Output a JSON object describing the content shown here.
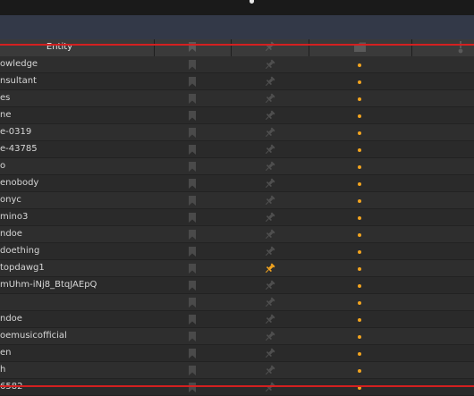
{
  "header": {
    "entity_label": "Entity",
    "columns": [
      "bookmark-icon",
      "pin-icon",
      "status-icon",
      "info-icon"
    ]
  },
  "colors": {
    "accent_red": "#d42020",
    "status_dot": "#f2a41f",
    "pin_active": "#f2a41f"
  },
  "rows": [
    {
      "entity": "owledge",
      "pinned": false
    },
    {
      "entity": "nsultant",
      "pinned": false
    },
    {
      "entity": "es",
      "pinned": false
    },
    {
      "entity": "ne",
      "pinned": false
    },
    {
      "entity": "e-0319",
      "pinned": false
    },
    {
      "entity": "e-43785",
      "pinned": false
    },
    {
      "entity": "o",
      "pinned": false
    },
    {
      "entity": "enobody",
      "pinned": false
    },
    {
      "entity": "onyc",
      "pinned": false
    },
    {
      "entity": "mino3",
      "pinned": false
    },
    {
      "entity": "ndoe",
      "pinned": false
    },
    {
      "entity": "doething",
      "pinned": false
    },
    {
      "entity": "topdawg1",
      "pinned": true
    },
    {
      "entity": "mUhm-iNj8_BtqJAEpQ",
      "pinned": false
    },
    {
      "entity": "",
      "pinned": false
    },
    {
      "entity": "ndoe",
      "pinned": false
    },
    {
      "entity": "oemusicofficial",
      "pinned": false
    },
    {
      "entity": "en",
      "pinned": false
    },
    {
      "entity": "h",
      "pinned": false
    },
    {
      "entity": "6582",
      "pinned": false
    }
  ]
}
